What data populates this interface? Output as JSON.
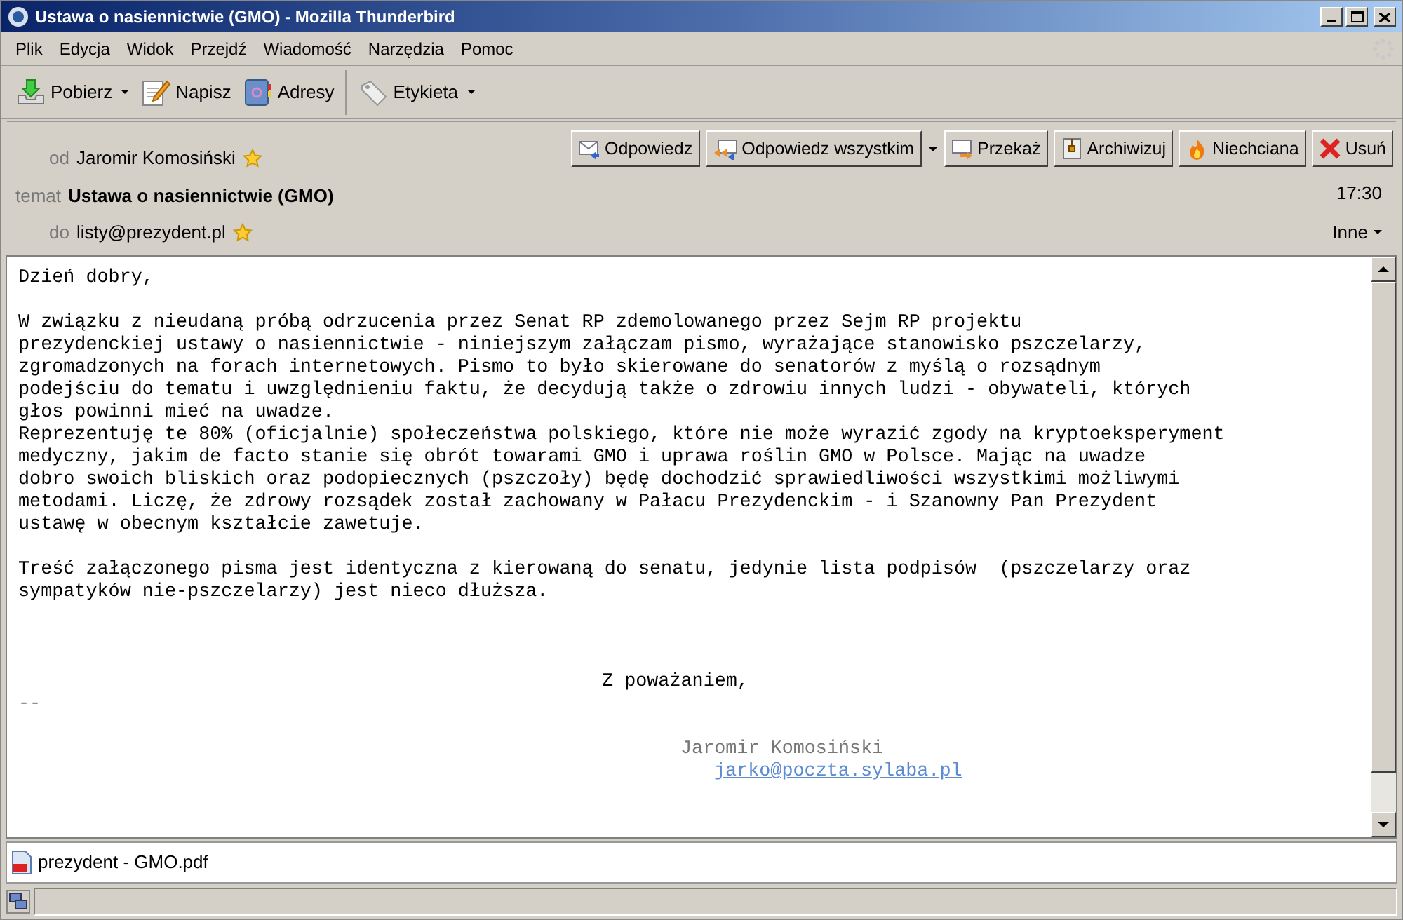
{
  "window": {
    "title": "Ustawa o nasiennictwie (GMO) - Mozilla Thunderbird"
  },
  "menu": [
    {
      "label": "Plik"
    },
    {
      "label": "Edycja"
    },
    {
      "label": "Widok"
    },
    {
      "label": "Przejdź"
    },
    {
      "label": "Wiadomość"
    },
    {
      "label": "Narzędzia"
    },
    {
      "label": "Pomoc"
    }
  ],
  "toolbar": [
    {
      "label": "Pobierz",
      "kind": "download",
      "dropdown": true
    },
    {
      "label": "Napisz",
      "kind": "write",
      "dropdown": false
    },
    {
      "label": "Adresy",
      "kind": "addressbook",
      "dropdown": false
    },
    {
      "label": "Etykieta",
      "kind": "tag",
      "dropdown": true
    }
  ],
  "header": {
    "from_label": "od",
    "from": "Jaromir Komosiński",
    "subject_label": "temat",
    "subject": "Ustawa o nasiennictwie (GMO)",
    "time": "17:30",
    "to_label": "do",
    "to": "listy@prezydent.pl",
    "other": "Inne"
  },
  "actions": [
    {
      "label": "Odpowiedz",
      "kind": "reply",
      "dropdown": false
    },
    {
      "label": "Odpowiedz wszystkim",
      "kind": "replyall",
      "dropdown": true
    },
    {
      "label": "Przekaż",
      "kind": "forward",
      "dropdown": false
    },
    {
      "label": "Archiwizuj",
      "kind": "archive",
      "dropdown": false
    },
    {
      "label": "Niechciana",
      "kind": "junk",
      "dropdown": false
    },
    {
      "label": "Usuń",
      "kind": "delete",
      "dropdown": false
    }
  ],
  "body": [
    {
      "kind": "text",
      "lines": [
        "Dzień dobry,"
      ]
    },
    {
      "kind": "text",
      "lines": [
        "W związku z nieudaną próbą odrzucenia przez Senat RP zdemolowanego przez Sejm RP projektu",
        "prezydenckiej ustawy o nasiennictwie - niniejszym załączam pismo, wyrażające stanowisko pszczelarzy,",
        "zgromadzonych na forach internetowych. Pismo to było skierowane do senatorów z myślą o rozsądnym",
        "podejściu do tematu i uwzględnieniu faktu, że decydują także o zdrowiu innych ludzi - obywateli, których",
        "głos powinni mieć na uwadze.",
        "Reprezentuję te 80% (oficjalnie) społeczeństwa polskiego, które nie może wyrazić zgody na kryptoeksperyment",
        "medyczny, jakim de facto stanie się obrót towarami GMO i uprawa roślin GMO w Polsce. Mając na uwadze",
        "dobro swoich bliskich oraz podopiecznych (pszczoły) będę dochodzić sprawiedliwości wszystkimi możliwymi",
        "metodami. Liczę, że zdrowy rozsądek został zachowany w Pałacu Prezydenckim - i Szanowny Pan Prezydent",
        "ustawę w obecnym kształcie zawetuje."
      ]
    },
    {
      "kind": "text",
      "lines": [
        "Treść załączonego pisma jest identyczna z kierowaną do senatu, jedynie lista podpisów  (pszczelarzy oraz",
        "sympatyków nie-pszczelarzy) jest nieco dłuższa."
      ]
    },
    {
      "kind": "closing",
      "lines": [
        "Z poważaniem,"
      ]
    },
    {
      "kind": "separator",
      "lines": [
        "--"
      ]
    },
    {
      "kind": "signature",
      "lines": [
        "Jaromir Komosiński"
      ]
    },
    {
      "kind": "link",
      "lines": [
        "jarko@poczta.sylaba.pl"
      ]
    }
  ],
  "attachments": [
    {
      "name": "prezydent - GMO.pdf"
    }
  ]
}
